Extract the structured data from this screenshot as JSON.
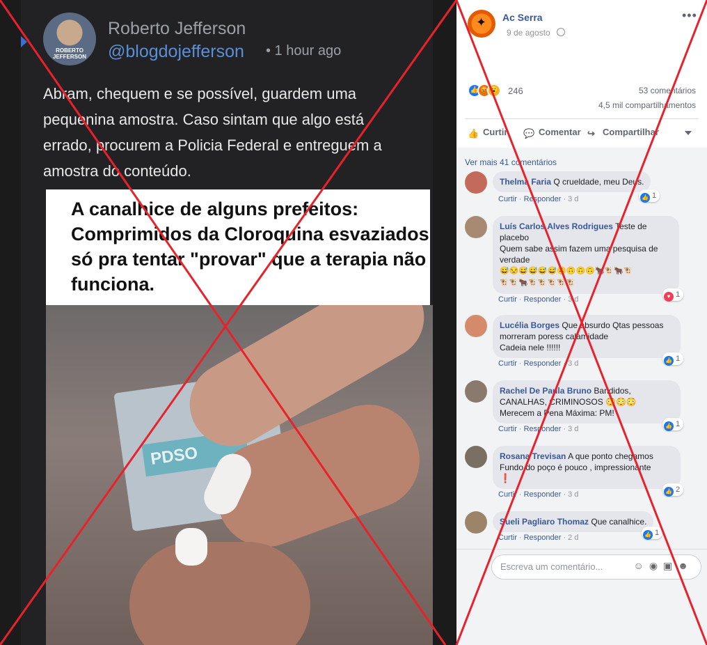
{
  "tweet": {
    "author": "Roberto Jefferson",
    "handle": "@blogdojefferson",
    "time": "• 1 hour ago",
    "avatar_text": "ROBERTO JEFFERSON",
    "text": "Abram, chequem e se possível, guardem uma pequenina amostra. Caso sintam que algo está errado, procurem a Policia Federal e entreguem a amostra do conteúdo.",
    "meme_caption": "A canalhice de alguns prefeitos: Comprimidos da Cloroquina esvaziados só pra tentar \"provar\" que a terapia não funciona.",
    "pack_text": "PDSO"
  },
  "post": {
    "page_name": "Ac Serra",
    "date": "9 de agosto",
    "more": "•••",
    "reaction_count": "246",
    "comments_count": "53 comentários",
    "shares_count": "4,5 mil compartilhamentos",
    "actions": {
      "like": "Curtir",
      "comment": "Comentar",
      "share": "Compartilhar"
    },
    "see_more": "Ver mais 41 comentários"
  },
  "comments": [
    {
      "author": "Thelma Faria",
      "text": "Q crueldade, meu Deus.",
      "like": "Curtir",
      "reply": "Responder",
      "age": "3 d",
      "reactions": "1",
      "reaction_type": "like"
    },
    {
      "author": "Luís Carlos Alves Rodrigues",
      "text": "Teste de placebo\nQuem sabe assim fazem uma pesquisa de verdade",
      "emoji": "😅😒😅😅😅😅🙃🙃🙃🙃🐂🐮🐂🐮\n🐮🐮🐂🐮🐮🐮🐮🐮",
      "like": "Curtir",
      "reply": "Responder",
      "age": "3 d",
      "reactions": "1",
      "reaction_type": "heart"
    },
    {
      "author": "Lucélia Borges",
      "text": "Que absurdo Qtas pessoas morreram poress calamidade\nCadeia nele !!!!!!",
      "like": "Curtir",
      "reply": "Responder",
      "age": "3 d",
      "reactions": "1",
      "reaction_type": "like"
    },
    {
      "author": "Rachel De Paula Bruno",
      "text": "Bandidos, CANALHAS, CRIMINOSOS 😳😳😳\nMerecem a Pena Máxima: PM!",
      "like": "Curtir",
      "reply": "Responder",
      "age": "3 d",
      "reactions": "1",
      "reaction_type": "like"
    },
    {
      "author": "Rosana Trevisan",
      "text": "A que ponto chegamos\nFundo do poço é pouco , impressionante",
      "emoji": "❗",
      "like": "Curtir",
      "reply": "Responder",
      "age": "3 d",
      "reactions": "2",
      "reaction_type": "like"
    },
    {
      "author": "Sueli Pagliaro Thomaz",
      "text": "Que canalhice.",
      "like": "Curtir",
      "reply": "Responder",
      "age": "2 d",
      "reactions": "1",
      "reaction_type": "like"
    }
  ],
  "compose": {
    "placeholder": "Escreva um comentário..."
  },
  "overlay": {
    "color": "#e8212b"
  }
}
